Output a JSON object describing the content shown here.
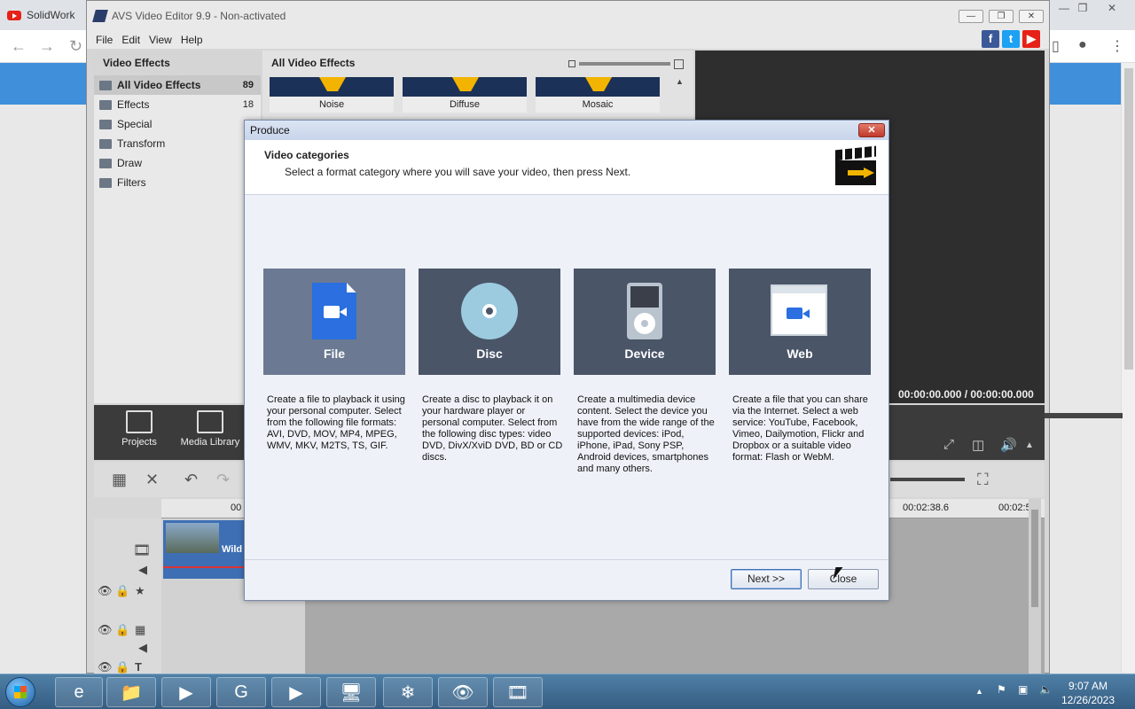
{
  "browser": {
    "tab_title": "SolidWork",
    "back_glyph": "←",
    "forward_glyph": "→",
    "reload_glyph": "↻",
    "window_controls": [
      "—",
      "❐",
      "✕"
    ]
  },
  "app": {
    "title": "AVS Video Editor 9.9 - Non-activated",
    "window_controls": [
      "—",
      "❐",
      "✕"
    ],
    "menu": [
      "File",
      "Edit",
      "View",
      "Help"
    ],
    "social": [
      {
        "label": "f",
        "color": "#3b5998"
      },
      {
        "label": "t",
        "color": "#1da1f2"
      },
      {
        "label": "▶",
        "color": "#e62117"
      }
    ],
    "sidebar": {
      "header": "Video Effects",
      "items": [
        {
          "label": "All Video Effects",
          "count": "89"
        },
        {
          "label": "Effects",
          "count": "18"
        },
        {
          "label": "Special",
          "count": ""
        },
        {
          "label": "Transform",
          "count": ""
        },
        {
          "label": "Draw",
          "count": ""
        },
        {
          "label": "Filters",
          "count": ""
        }
      ]
    },
    "effects": {
      "header": "All Video Effects",
      "thumbs": [
        "Noise",
        "Diffuse",
        "Mosaic"
      ]
    },
    "preview": {
      "time_current": "00:00:00.000",
      "time_separator": "/",
      "time_total": "00:00:00.000"
    },
    "toolbar": {
      "projects": "Projects",
      "media_library": "Media Library"
    },
    "timeline": {
      "ruler_marks": [
        "00",
        "00:02:38.6",
        "00:02:5"
      ],
      "clip_name": "Wild"
    }
  },
  "dialog": {
    "title": "Produce",
    "close_glyph": "✕",
    "heading": "Video categories",
    "subheading": "Select a format category where you will save your video, then press Next.",
    "categories": [
      {
        "label": "File",
        "description": "Create a file to playback it using your personal computer. Select from the following file formats: AVI, DVD, MOV, MP4, MPEG, WMV, MKV, M2TS, TS, GIF."
      },
      {
        "label": "Disc",
        "description": "Create a disc to playback it on your hardware player or personal computer. Select from the following disc types: video DVD, DivX/XviD DVD, BD or CD discs."
      },
      {
        "label": "Device",
        "description": "Create a multimedia device content. Select the device you have from the wide range of the supported devices: iPod, iPhone, iPad, Sony PSP, Android devices, smartphones and many others."
      },
      {
        "label": "Web",
        "description": "Create a file that you can share via the Internet. Select a web service: YouTube, Facebook, Vimeo, Dailymotion, Flickr and Dropbox or a suitable video format: Flash or WebM."
      }
    ],
    "selected_category": "File",
    "next_label": "Next >>",
    "close_label": "Close"
  },
  "taskbar": {
    "items": [
      "e",
      "📁",
      "▶",
      "G",
      "▶",
      "🖥",
      "❄",
      "👁",
      "🎞"
    ],
    "tray_arrow": "▲",
    "time": "9:07 AM",
    "date": "12/26/2023"
  }
}
